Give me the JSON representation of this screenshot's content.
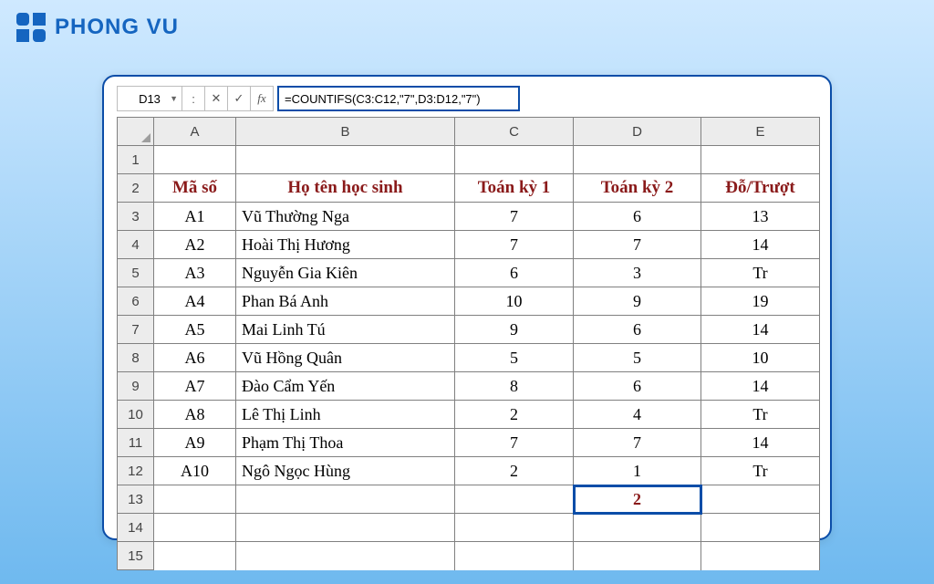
{
  "brand": "PHONG VU",
  "formula_bar": {
    "cell_ref": "D13",
    "btn_cancel": "✕",
    "btn_enter": "✓",
    "btn_fx": "fx",
    "formula": "=COUNTIFS(C3:C12,\"7\",D3:D12,\"7\")"
  },
  "column_headers": [
    "A",
    "B",
    "C",
    "D",
    "E"
  ],
  "row_headers": [
    "1",
    "2",
    "3",
    "4",
    "5",
    "6",
    "7",
    "8",
    "9",
    "10",
    "11",
    "12",
    "13",
    "14",
    "15"
  ],
  "header_row": {
    "A": "Mã số",
    "B": "Họ tên học sinh",
    "C": "Toán kỳ 1",
    "D": "Toán kỳ 2",
    "E": "Đỗ/Trượt"
  },
  "data_rows": [
    {
      "A": "A1",
      "B": "Vũ Thường Nga",
      "C": "7",
      "D": "6",
      "E": "13"
    },
    {
      "A": "A2",
      "B": "Hoài Thị Hương",
      "C": "7",
      "D": "7",
      "E": "14"
    },
    {
      "A": "A3",
      "B": "Nguyễn Gia Kiên",
      "C": "6",
      "D": "3",
      "E": "Tr"
    },
    {
      "A": "A4",
      "B": "Phan Bá Anh",
      "C": "10",
      "D": "9",
      "E": "19"
    },
    {
      "A": "A5",
      "B": "Mai Linh Tú",
      "C": "9",
      "D": "6",
      "E": "14"
    },
    {
      "A": "A6",
      "B": "Vũ Hồng Quân",
      "C": "5",
      "D": "5",
      "E": "10"
    },
    {
      "A": "A7",
      "B": "Đào Cẩm Yến",
      "C": "8",
      "D": "6",
      "E": "14"
    },
    {
      "A": "A8",
      "B": "Lê Thị Linh",
      "C": "2",
      "D": "4",
      "E": "Tr"
    },
    {
      "A": "A9",
      "B": "Phạm Thị Thoa",
      "C": "7",
      "D": "7",
      "E": "14"
    },
    {
      "A": "A10",
      "B": "Ngô Ngọc Hùng",
      "C": "2",
      "D": "1",
      "E": "Tr"
    }
  ],
  "result_cell": "2"
}
